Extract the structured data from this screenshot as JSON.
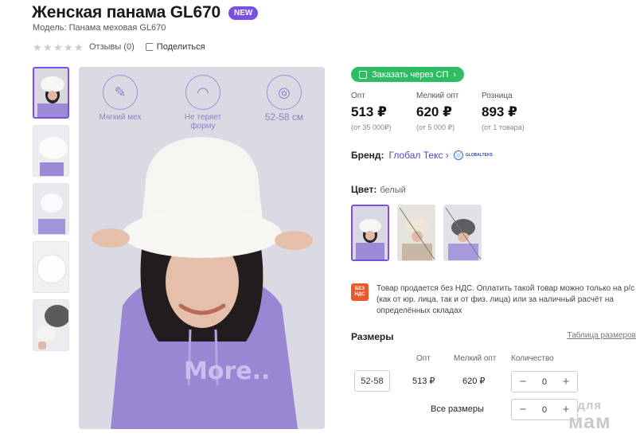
{
  "product": {
    "title": "Женская панама GL670",
    "badge": "NEW",
    "model": "Модель: Панама меховая GL670",
    "reviews": "Отзывы (0)",
    "share": "Поделиться",
    "rating_stars": 0
  },
  "photo": {
    "features": [
      {
        "icon": "feather-icon",
        "label": "Мягкий мех"
      },
      {
        "icon": "hat-icon",
        "label": "Не теряет форму"
      },
      {
        "icon": "tape-measure-icon",
        "label": "52-58 см"
      }
    ],
    "hoodie_text": "More.."
  },
  "order_button": "Заказать через СП",
  "prices": [
    {
      "label": "Опт",
      "value": "513 ₽",
      "note": "(от 35 000₽)"
    },
    {
      "label": "Мелкий опт",
      "value": "620 ₽",
      "note": "(от 5 000 ₽)"
    },
    {
      "label": "Розница",
      "value": "893 ₽",
      "note": "(от 1 товара)"
    }
  ],
  "brand": {
    "label": "Бренд:",
    "name": "Глобал Текс",
    "logo_text": "GLOBALTEKS"
  },
  "color": {
    "label": "Цвет:",
    "value": "белый"
  },
  "notice": {
    "icon_text": "БЕЗ НДС",
    "text": "Товар продается без НДС. Оплатить такой товар можно только на р/с (как от юр. лица, так и от физ. лица) или за наличный расчёт на определённых складах"
  },
  "sizes": {
    "title": "Размеры",
    "table_link": "Таблица размеров",
    "columns": [
      "Опт",
      "Мелкий опт",
      "Количество"
    ],
    "rows": [
      {
        "size": "52-58",
        "opt": "513 ₽",
        "small_opt": "620 ₽",
        "qty": "0"
      }
    ],
    "all_sizes_label": "Все размеры",
    "all_qty": "0"
  },
  "watermark": {
    "line1": "для",
    "line2": "мам"
  },
  "colors": {
    "accent": "#7b4fe0",
    "cta": "#2dbe64",
    "brand_link": "#5a43c7",
    "notice": "#e85a2c"
  }
}
